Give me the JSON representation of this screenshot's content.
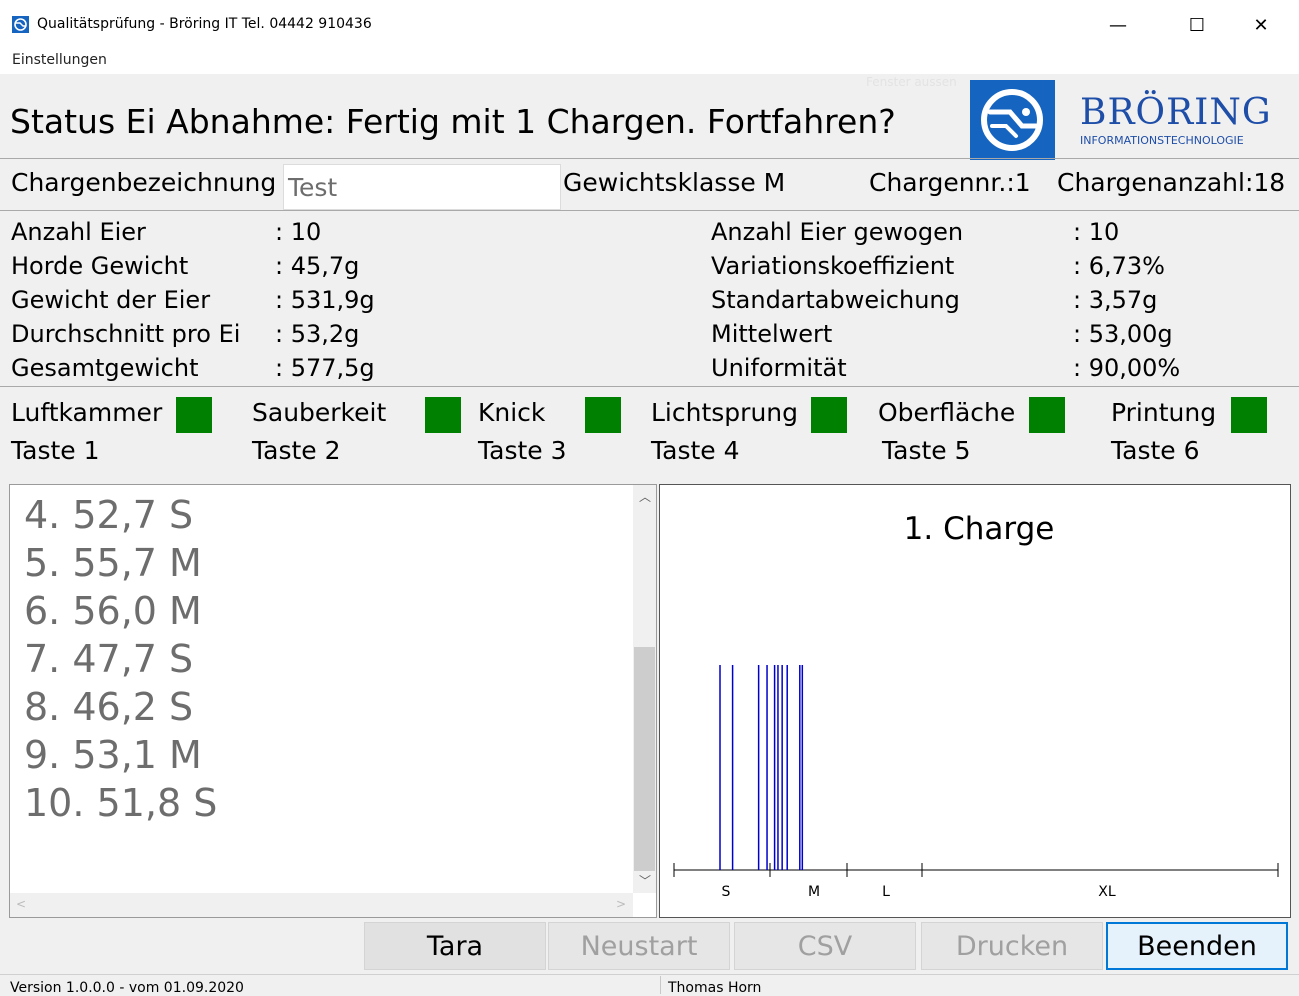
{
  "window": {
    "title": "Qualitätsprüfung - Bröring IT  Tel. 04442 910436",
    "minimize": "—",
    "maximize": "☐",
    "close": "✕"
  },
  "menu": {
    "settings": "Einstellungen"
  },
  "header": {
    "status": "Status Ei Abnahme: Fertig mit 1 Chargen. Fortfahren?",
    "faded_hint": "Fenster aussen",
    "logo_name": "BRÖRING",
    "logo_sub": "INFORMATIONSTECHNOLOGIE"
  },
  "charge": {
    "label": "Chargenbezeichnung",
    "value": "Test",
    "weight_class": "Gewichtsklasse M",
    "number": "Chargennr.:1",
    "count": "Chargenanzahl:18"
  },
  "stats_left": [
    {
      "label": "Anzahl Eier",
      "value": ": 10"
    },
    {
      "label": "Horde Gewicht",
      "value": ": 45,7g"
    },
    {
      "label": "Gewicht der Eier",
      "value": ": 531,9g"
    },
    {
      "label": "Durchschnitt pro Ei",
      "value": ": 53,2g"
    },
    {
      "label": "Gesamtgewicht",
      "value": ": 577,5g"
    }
  ],
  "stats_right": [
    {
      "label": "Anzahl Eier gewogen",
      "value": ": 10"
    },
    {
      "label": "Variationskoeffizient",
      "value": ": 6,73%"
    },
    {
      "label": "Standartabweichung",
      "value": ": 3,57g"
    },
    {
      "label": "Mittelwert",
      "value": ": 53,00g"
    },
    {
      "label": "Uniformität",
      "value": ": 90,00%"
    }
  ],
  "checks": [
    {
      "label": "Luftkammer",
      "key": "Taste 1",
      "color": "#008000"
    },
    {
      "label": "Sauberkeit",
      "key": "Taste 2",
      "color": "#008000"
    },
    {
      "label": "Knick",
      "key": "Taste 3",
      "color": "#008000"
    },
    {
      "label": "Lichtsprung",
      "key": "Taste 4",
      "color": "#008000"
    },
    {
      "label": "Oberfläche",
      "key": "Taste 5",
      "color": "#008000"
    },
    {
      "label": "Printung",
      "key": "Taste 6",
      "color": "#008000"
    }
  ],
  "entries": [
    "4. 52,7 S",
    "5. 55,7 M",
    "6. 56,0 M",
    "7. 47,7 S",
    "8. 46,2 S",
    "9. 53,1 M",
    "10. 51,8 S"
  ],
  "chart_data": {
    "type": "scatter",
    "title": "1. Charge",
    "categories": [
      "S",
      "M",
      "L",
      "XL"
    ],
    "values": [
      46.2,
      47.7,
      50.8,
      51.8,
      52.7,
      53.1,
      53.6,
      54.2,
      55.7,
      56.0
    ],
    "color": "#0000cc"
  },
  "buttons": {
    "tara": "Tara",
    "restart": "Neustart",
    "csv": "CSV",
    "print": "Drucken",
    "quit": "Beenden"
  },
  "statusbar": {
    "version": "Version 1.0.0.0 - vom 01.09.2020",
    "user": "Thomas Horn"
  }
}
